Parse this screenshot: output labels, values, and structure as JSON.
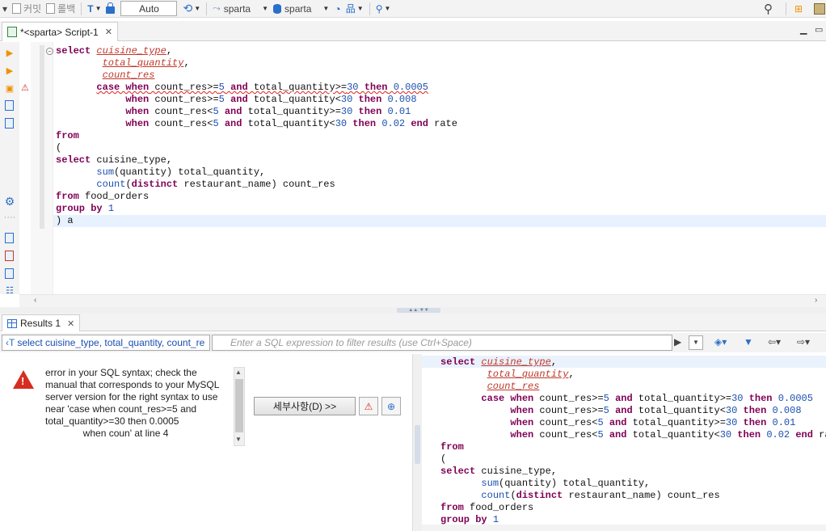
{
  "toolbar": {
    "commit": "커밋",
    "rollback": "롤백",
    "transaction_mode": "Auto",
    "schema": "sparta",
    "datasource": "sparta"
  },
  "editor": {
    "tab_title": "*<sparta> Script-1",
    "lines": [
      [
        [
          "kw",
          "select "
        ],
        [
          "err",
          "cuisine_type"
        ],
        [
          "plain",
          ","
        ]
      ],
      [
        [
          "plain",
          "        "
        ],
        [
          "err",
          "total_quantity"
        ],
        [
          "plain",
          ","
        ]
      ],
      [
        [
          "plain",
          "        "
        ],
        [
          "err",
          "count_res"
        ]
      ],
      [
        [
          "plain",
          "       "
        ],
        [
          "kw squig",
          "case when"
        ],
        [
          "plain squig",
          " count_res>="
        ],
        [
          "num squig",
          "5"
        ],
        [
          "plain squig",
          " "
        ],
        [
          "kw squig",
          "and"
        ],
        [
          "plain squig",
          " total_quantity>="
        ],
        [
          "num squig",
          "30"
        ],
        [
          "plain squig",
          " "
        ],
        [
          "kw squig",
          "then"
        ],
        [
          "plain squig",
          " "
        ],
        [
          "num squig",
          "0.0005"
        ]
      ],
      [
        [
          "plain",
          "            "
        ],
        [
          "kw",
          "when"
        ],
        [
          "plain",
          " count_res>="
        ],
        [
          "num",
          "5"
        ],
        [
          "plain",
          " "
        ],
        [
          "kw",
          "and"
        ],
        [
          "plain",
          " total_quantity<"
        ],
        [
          "num",
          "30"
        ],
        [
          "plain",
          " "
        ],
        [
          "kw",
          "then"
        ],
        [
          "plain",
          " "
        ],
        [
          "num",
          "0.008"
        ]
      ],
      [
        [
          "plain",
          "            "
        ],
        [
          "kw",
          "when"
        ],
        [
          "plain",
          " count_res<"
        ],
        [
          "num",
          "5"
        ],
        [
          "plain",
          " "
        ],
        [
          "kw",
          "and"
        ],
        [
          "plain",
          " total_quantity>="
        ],
        [
          "num",
          "30"
        ],
        [
          "plain",
          " "
        ],
        [
          "kw",
          "then"
        ],
        [
          "plain",
          " "
        ],
        [
          "num",
          "0.01"
        ]
      ],
      [
        [
          "plain",
          "            "
        ],
        [
          "kw",
          "when"
        ],
        [
          "plain",
          " count_res<"
        ],
        [
          "num",
          "5"
        ],
        [
          "plain",
          " "
        ],
        [
          "kw",
          "and"
        ],
        [
          "plain",
          " total_quantity<"
        ],
        [
          "num",
          "30"
        ],
        [
          "plain",
          " "
        ],
        [
          "kw",
          "then"
        ],
        [
          "plain",
          " "
        ],
        [
          "num",
          "0.02"
        ],
        [
          "plain",
          " "
        ],
        [
          "kw",
          "end"
        ],
        [
          "plain",
          " rate"
        ]
      ],
      [
        [
          "kw",
          "from"
        ]
      ],
      [
        [
          "plain",
          "("
        ]
      ],
      [
        [
          "kw",
          "select"
        ],
        [
          "plain",
          " cuisine_type,"
        ]
      ],
      [
        [
          "plain",
          "       "
        ],
        [
          "fn",
          "sum"
        ],
        [
          "plain",
          "(quantity) total_quantity,"
        ]
      ],
      [
        [
          "plain",
          "       "
        ],
        [
          "fn",
          "count"
        ],
        [
          "plain",
          "("
        ],
        [
          "kw",
          "distinct"
        ],
        [
          "plain",
          " restaurant_name) count_res"
        ]
      ],
      [
        [
          "kw",
          "from"
        ],
        [
          "plain",
          " food_orders"
        ]
      ],
      [
        [
          "kw",
          "group by"
        ],
        [
          "plain",
          " "
        ],
        [
          "num",
          "1"
        ]
      ],
      [
        [
          "plain",
          ") a"
        ]
      ]
    ]
  },
  "results": {
    "tab_label": "Results 1",
    "query_label": "select cuisine_type, total_quantity, count_re",
    "filter_placeholder": "Enter a SQL expression to filter results (use Ctrl+Space)",
    "error_lines": [
      "error in your SQL syntax; check the",
      "manual that corresponds to your MySQL",
      "server version for the right syntax to use",
      "near 'case when count_res>=5 and",
      "total_quantity>=30 then 0.0005",
      "              when coun' at line 4"
    ],
    "details_button": "세부사항(D) >>",
    "sql_lines": [
      [
        [
          "kw",
          "select "
        ],
        [
          "err",
          "cuisine_type"
        ],
        [
          "plain",
          ","
        ]
      ],
      [
        [
          "plain",
          "        "
        ],
        [
          "err",
          "total_quantity"
        ],
        [
          "plain",
          ","
        ]
      ],
      [
        [
          "plain",
          "        "
        ],
        [
          "err",
          "count_res"
        ]
      ],
      [
        [
          "plain",
          "       "
        ],
        [
          "kw",
          "case when"
        ],
        [
          "plain",
          " count_res>="
        ],
        [
          "num",
          "5"
        ],
        [
          "plain",
          " "
        ],
        [
          "kw",
          "and"
        ],
        [
          "plain",
          " total_quantity>="
        ],
        [
          "num",
          "30"
        ],
        [
          "plain",
          " "
        ],
        [
          "kw",
          "then"
        ],
        [
          "plain",
          " "
        ],
        [
          "num",
          "0.0005"
        ]
      ],
      [
        [
          "plain",
          "            "
        ],
        [
          "kw",
          "when"
        ],
        [
          "plain",
          " count_res>="
        ],
        [
          "num",
          "5"
        ],
        [
          "plain",
          " "
        ],
        [
          "kw",
          "and"
        ],
        [
          "plain",
          " total_quantity<"
        ],
        [
          "num",
          "30"
        ],
        [
          "plain",
          " "
        ],
        [
          "kw",
          "then"
        ],
        [
          "plain",
          " "
        ],
        [
          "num",
          "0.008"
        ]
      ],
      [
        [
          "plain",
          "            "
        ],
        [
          "kw",
          "when"
        ],
        [
          "plain",
          " count_res<"
        ],
        [
          "num",
          "5"
        ],
        [
          "plain",
          " "
        ],
        [
          "kw",
          "and"
        ],
        [
          "plain",
          " total_quantity>="
        ],
        [
          "num",
          "30"
        ],
        [
          "plain",
          " "
        ],
        [
          "kw",
          "then"
        ],
        [
          "plain",
          " "
        ],
        [
          "num",
          "0.01"
        ]
      ],
      [
        [
          "plain",
          "            "
        ],
        [
          "kw",
          "when"
        ],
        [
          "plain",
          " count_res<"
        ],
        [
          "num",
          "5"
        ],
        [
          "plain",
          " "
        ],
        [
          "kw",
          "and"
        ],
        [
          "plain",
          " total_quantity<"
        ],
        [
          "num",
          "30"
        ],
        [
          "plain",
          " "
        ],
        [
          "kw",
          "then"
        ],
        [
          "plain",
          " "
        ],
        [
          "num",
          "0.02"
        ],
        [
          "plain",
          " "
        ],
        [
          "kw",
          "end"
        ],
        [
          "plain",
          " ra"
        ]
      ],
      [
        [
          "kw",
          "from"
        ]
      ],
      [
        [
          "plain",
          "("
        ]
      ],
      [
        [
          "kw",
          "select"
        ],
        [
          "plain",
          " cuisine_type,"
        ]
      ],
      [
        [
          "plain",
          "       "
        ],
        [
          "fn",
          "sum"
        ],
        [
          "plain",
          "(quantity) total_quantity,"
        ]
      ],
      [
        [
          "plain",
          "       "
        ],
        [
          "fn",
          "count"
        ],
        [
          "plain",
          "("
        ],
        [
          "kw",
          "distinct"
        ],
        [
          "plain",
          " restaurant_name) count_res"
        ]
      ],
      [
        [
          "kw",
          "from"
        ],
        [
          "plain",
          " food_orders"
        ]
      ],
      [
        [
          "kw",
          "group by"
        ],
        [
          "plain",
          " "
        ],
        [
          "num",
          "1"
        ]
      ]
    ]
  },
  "colors": {
    "keyword": "#7f0055",
    "error_identifier": "#c0392b",
    "number": "#1a4fb0",
    "error_icon": "#d62d20",
    "run_icon": "#f29000"
  },
  "icons": [
    "commit-icon",
    "rollback-icon",
    "transaction-icon",
    "lock-icon",
    "history-icon",
    "schema-icon",
    "database-icon",
    "dashboard-icon",
    "tree-icon",
    "search-icon",
    "run-icon",
    "warning-icon",
    "settings-icon",
    "info-icon"
  ]
}
